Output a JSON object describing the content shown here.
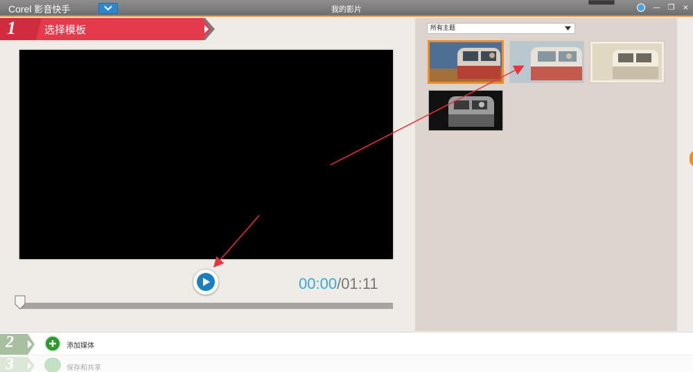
{
  "app": {
    "brand": "Corel",
    "product": "影音快手",
    "project_name": "我的影片"
  },
  "steps": [
    {
      "number": "1",
      "label": "选择模板"
    },
    {
      "number": "2",
      "label": "添加媒体"
    },
    {
      "number": "3",
      "label": "保存和共享"
    }
  ],
  "player": {
    "current_time": "00:00",
    "separator": "/",
    "total_time": "01:11",
    "progress": 0
  },
  "themes": {
    "filter_value": "所有主题",
    "selected_index": 0
  },
  "colors": {
    "accent": "#f28c28",
    "step_red": "#e43a4c",
    "play_blue": "#1b7fc0",
    "time_blue": "#3ba9d6"
  }
}
